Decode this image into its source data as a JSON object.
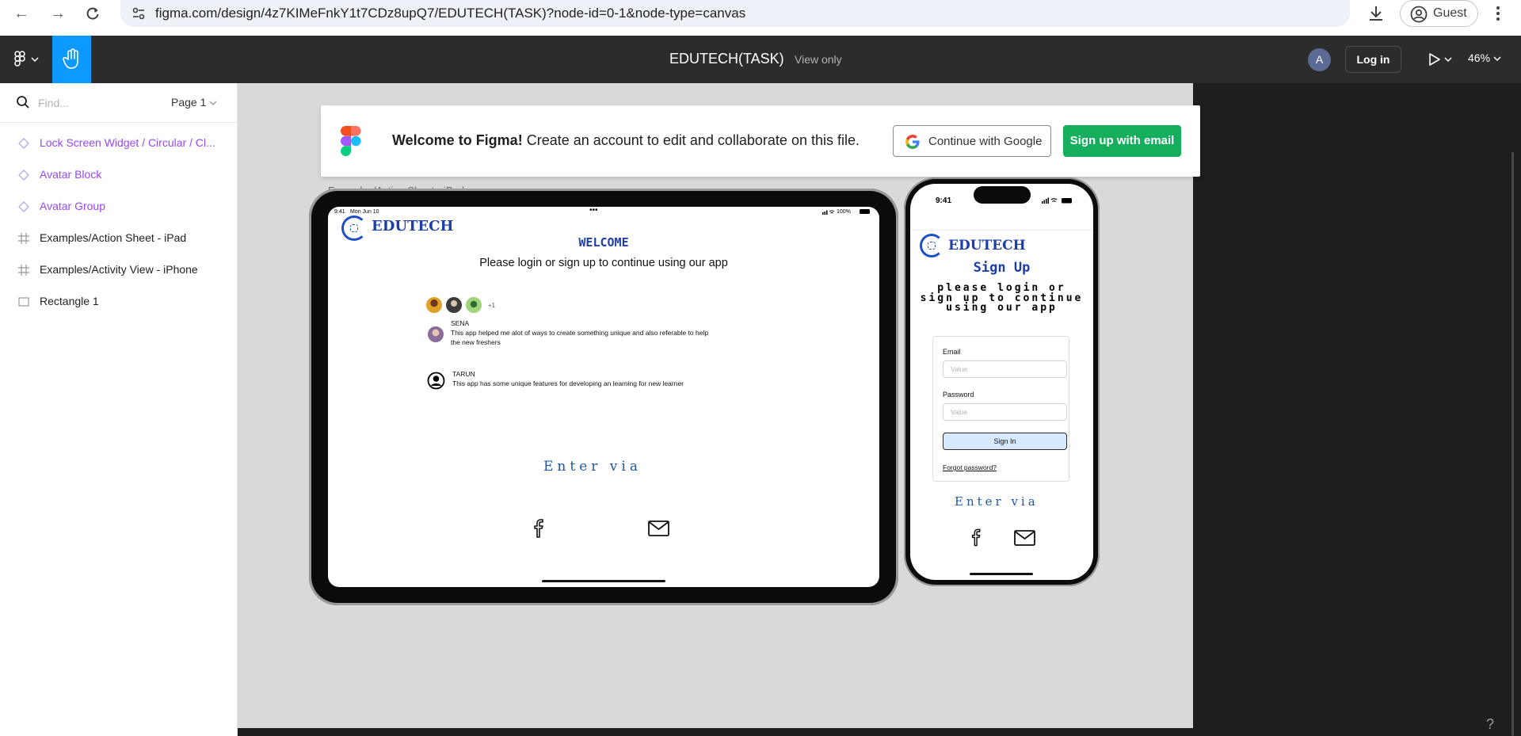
{
  "browser": {
    "url": "figma.com/design/4z7KIMeFnkY1t7CDz8upQ7/EDUTECH(TASK)?node-id=0-1&node-type=canvas",
    "guest_label": "Guest"
  },
  "toolbar": {
    "file_title": "EDUTECH(TASK)",
    "mode": "View only",
    "avatar_initial": "A",
    "login_label": "Log in",
    "zoom": "46%",
    "accent": "#0d99ff"
  },
  "sidebar": {
    "search_placeholder": "Find...",
    "page": "Page 1",
    "layers": [
      {
        "name": "Lock Screen Widget / Circular / Cl...",
        "kind": "component"
      },
      {
        "name": "Avatar Block",
        "kind": "component"
      },
      {
        "name": "Avatar Group",
        "kind": "component"
      },
      {
        "name": "Examples/Action Sheet - iPad",
        "kind": "frame"
      },
      {
        "name": "Examples/Activity View - iPhone",
        "kind": "frame"
      },
      {
        "name": "Rectangle 1",
        "kind": "rectangle"
      }
    ]
  },
  "banner": {
    "title": "Welcome to Figma!",
    "text": "Create an account to edit and collaborate on this file.",
    "google_label": "Continue with Google",
    "email_label": "Sign up with email",
    "email_color": "#14ae5c"
  },
  "canvas": {
    "frame_label": "Examples/Action Sheet - iPad"
  },
  "ipad": {
    "time": "9:41",
    "date": "Mon Jun 10",
    "battery": "100%",
    "brand": "EDUTECH",
    "welcome": "WELCOME",
    "subtitle": "Please login or sign up to continue using our app",
    "avatar_more": "+1",
    "reviews": [
      {
        "name": "SENA",
        "text": "This app helped me alot of ways to create something unique and also referable to help the new freshers"
      },
      {
        "name": "TARUN",
        "text": "This app has some unique features for developing an learning for new learner"
      }
    ],
    "enter_via": "Enter via"
  },
  "iphone": {
    "time": "9:41",
    "brand": "EDUTECH",
    "title": "Sign Up",
    "subtitle": "please login or sign up to continue using our app",
    "email_label": "Email",
    "email_placeholder": "Value",
    "password_label": "Password",
    "password_placeholder": "Value",
    "signin_label": "Sign In",
    "forgot_label": "Forgot password?",
    "enter_via": "Enter via"
  },
  "help_label": "?"
}
